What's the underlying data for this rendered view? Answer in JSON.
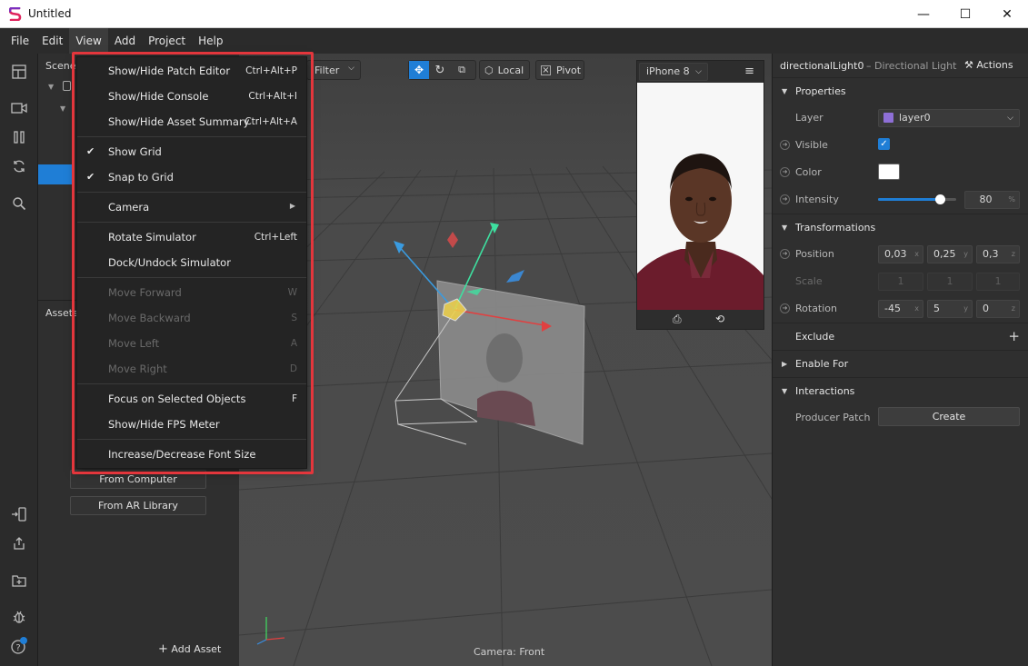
{
  "window": {
    "title": "Untitled",
    "minimize": "—",
    "maximize": "☐",
    "close": "✕"
  },
  "menubar": [
    "File",
    "Edit",
    "View",
    "Add",
    "Project",
    "Help"
  ],
  "scene_panel": {
    "title": "Scene"
  },
  "assets_panel": {
    "title": "Assets",
    "from_computer": "From Computer",
    "from_ar_library": "From AR Library",
    "add_asset": "Add Asset"
  },
  "viewport": {
    "filter": "Filter",
    "local": "Local",
    "pivot": "Pivot",
    "camera_label": "Camera: Front"
  },
  "simulator": {
    "device": "iPhone 8"
  },
  "inspector": {
    "object_name": "directionalLight0",
    "object_type": "– Directional Light",
    "actions": "Actions",
    "properties": "Properties",
    "layer_label": "Layer",
    "layer_value": "layer0",
    "layer_color": "#8e6fd6",
    "visible_label": "Visible",
    "color_label": "Color",
    "intensity_label": "Intensity",
    "intensity_value": "80",
    "intensity_unit": "%",
    "intensity_fraction": 0.8,
    "transformations": "Transformations",
    "position_label": "Position",
    "position": [
      "0,03",
      "0,25",
      "0,3"
    ],
    "scale_label": "Scale",
    "scale": [
      "1",
      "1",
      "1"
    ],
    "rotation_label": "Rotation",
    "rotation": [
      "-45",
      "5",
      "0"
    ],
    "axis_x": "x",
    "axis_y": "y",
    "axis_z": "z",
    "exclude": "Exclude",
    "enable_for": "Enable For",
    "interactions": "Interactions",
    "producer_patch": "Producer Patch",
    "create": "Create"
  },
  "view_menu": {
    "items": [
      {
        "label": "Show/Hide Patch Editor",
        "shortcut": "Ctrl+Alt+P"
      },
      {
        "label": "Show/Hide Console",
        "shortcut": "Ctrl+Alt+I"
      },
      {
        "label": "Show/Hide Asset Summary",
        "shortcut": "Ctrl+Alt+A"
      },
      {
        "label": "Show Grid",
        "check": "✔"
      },
      {
        "label": "Snap to Grid",
        "check": "✔"
      },
      {
        "label": "Camera"
      },
      {
        "label": "Rotate Simulator",
        "shortcut": "Ctrl+Left"
      },
      {
        "label": "Dock/Undock Simulator"
      },
      {
        "label": "Move Forward",
        "shortcut": "W"
      },
      {
        "label": "Move Backward",
        "shortcut": "S"
      },
      {
        "label": "Move Left",
        "shortcut": "A"
      },
      {
        "label": "Move Right",
        "shortcut": "D"
      },
      {
        "label": "Focus on Selected Objects",
        "shortcut": "F"
      },
      {
        "label": "Show/Hide FPS Meter"
      },
      {
        "label": "Increase/Decrease Font Size"
      }
    ]
  },
  "colors": {
    "accent": "#1f7ed6",
    "highlight": "#e3363c"
  }
}
